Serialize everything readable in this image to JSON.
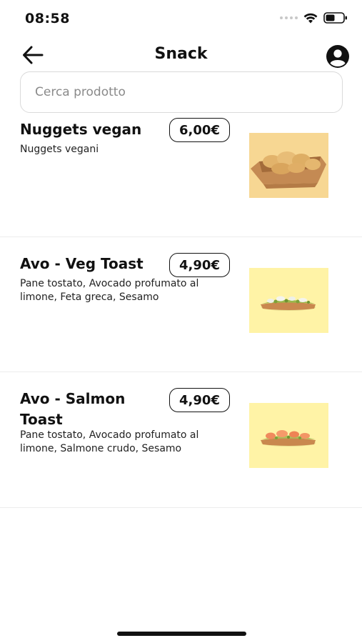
{
  "status_bar": {
    "time": "08:58"
  },
  "nav": {
    "title": "Snack"
  },
  "search": {
    "placeholder": "Cerca prodotto"
  },
  "products": [
    {
      "name": "Nuggets vegan",
      "price": "6,00€",
      "description": "Nuggets vegani"
    },
    {
      "name": "Avo - Veg Toast",
      "price": "4,90€",
      "description": "Pane tostato, Avocado profumato al limone, Feta greca, Sesamo"
    },
    {
      "name": "Avo - Salmon Toast",
      "price": "4,90€",
      "description": "Pane tostato, Avocado profumato al limone, Salmone crudo, Sesamo"
    }
  ],
  "colors": {
    "accent": "#111111",
    "divider": "#ececec",
    "nuggets_bg": "#f7d793",
    "toast_bg": "#fff3a6"
  },
  "icons": {
    "back": "arrow-left-icon",
    "profile": "user-circle-icon",
    "wifi": "wifi-icon",
    "battery": "battery-icon"
  }
}
